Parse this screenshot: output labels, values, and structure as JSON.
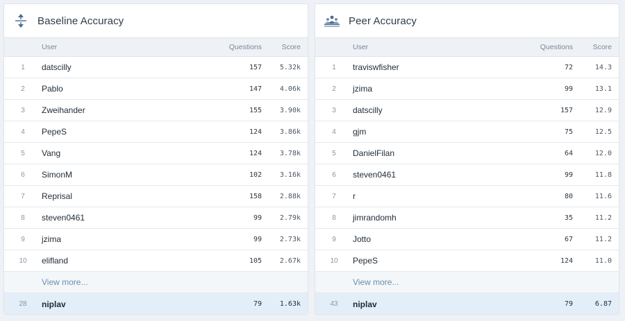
{
  "baseline": {
    "title": "Baseline Accuracy",
    "icon": "baseline-accuracy-icon",
    "headers": {
      "user": "User",
      "questions": "Questions",
      "score": "Score"
    },
    "rows": [
      {
        "rank": "1",
        "user": "datscilly",
        "questions": "157",
        "score": "5.32k"
      },
      {
        "rank": "2",
        "user": "Pablo",
        "questions": "147",
        "score": "4.06k"
      },
      {
        "rank": "3",
        "user": "Zweihander",
        "questions": "155",
        "score": "3.90k"
      },
      {
        "rank": "4",
        "user": "PepeS",
        "questions": "124",
        "score": "3.86k"
      },
      {
        "rank": "5",
        "user": "Vang",
        "questions": "124",
        "score": "3.78k"
      },
      {
        "rank": "6",
        "user": "SimonM",
        "questions": "102",
        "score": "3.16k"
      },
      {
        "rank": "7",
        "user": "Reprisal",
        "questions": "158",
        "score": "2.88k"
      },
      {
        "rank": "8",
        "user": "steven0461",
        "questions": "99",
        "score": "2.79k"
      },
      {
        "rank": "9",
        "user": "jzima",
        "questions": "99",
        "score": "2.73k"
      },
      {
        "rank": "10",
        "user": "elifland",
        "questions": "105",
        "score": "2.67k"
      }
    ],
    "view_more": "View more...",
    "me": {
      "rank": "28",
      "user": "niplav",
      "questions": "79",
      "score": "1.63k"
    }
  },
  "peer": {
    "title": "Peer Accuracy",
    "icon": "peer-accuracy-icon",
    "headers": {
      "user": "User",
      "questions": "Questions",
      "score": "Score"
    },
    "rows": [
      {
        "rank": "1",
        "user": "traviswfisher",
        "questions": "72",
        "score": "14.3"
      },
      {
        "rank": "2",
        "user": "jzima",
        "questions": "99",
        "score": "13.1"
      },
      {
        "rank": "3",
        "user": "datscilly",
        "questions": "157",
        "score": "12.9"
      },
      {
        "rank": "4",
        "user": "gjm",
        "questions": "75",
        "score": "12.5"
      },
      {
        "rank": "5",
        "user": "DanielFilan",
        "questions": "64",
        "score": "12.0"
      },
      {
        "rank": "6",
        "user": "steven0461",
        "questions": "99",
        "score": "11.8"
      },
      {
        "rank": "7",
        "user": "r",
        "questions": "80",
        "score": "11.6"
      },
      {
        "rank": "8",
        "user": "jimrandomh",
        "questions": "35",
        "score": "11.2"
      },
      {
        "rank": "9",
        "user": "Jotto",
        "questions": "67",
        "score": "11.2"
      },
      {
        "rank": "10",
        "user": "PepeS",
        "questions": "124",
        "score": "11.0"
      }
    ],
    "view_more": "View more...",
    "me": {
      "rank": "43",
      "user": "niplav",
      "questions": "79",
      "score": "6.87"
    }
  },
  "colors": {
    "page_bg": "#eef1f5",
    "header_row_bg": "#eef2f6",
    "highlight_row_bg": "#e4eef8",
    "link": "#6a8cb0",
    "icon": "#4a6a94"
  }
}
